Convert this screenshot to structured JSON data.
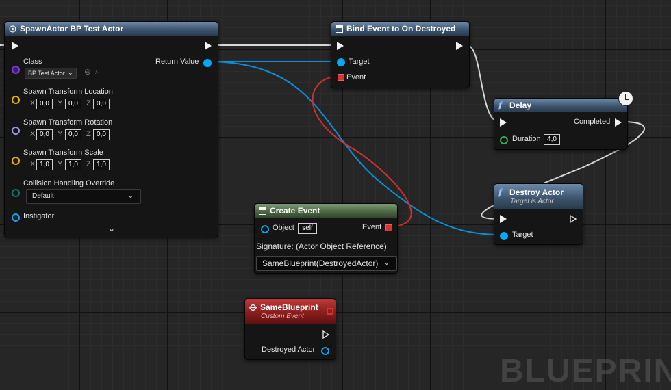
{
  "colors": {
    "exec_wire": "#d8d8d8",
    "object_wire": "#0a90d8",
    "delegate_wire": "#d23030",
    "function_header": "#3e5670",
    "create_event_header": "#4d6a45",
    "custom_event_header": "#8a1d1d"
  },
  "spawn_node": {
    "title": "SpawnActor BP Test Actor",
    "icon": "spawn-actor-icon",
    "class_label": "Class",
    "class_value": "BP Test Actor",
    "return_label": "Return Value",
    "location_label": "Spawn Transform Location",
    "location": {
      "x": "0,0",
      "y": "0,0",
      "z": "0,0"
    },
    "rotation_label": "Spawn Transform Rotation",
    "rotation": {
      "x": "0,0",
      "y": "0,0",
      "z": "0,0"
    },
    "scale_label": "Spawn Transform Scale",
    "scale": {
      "x": "1,0",
      "y": "1,0",
      "z": "1,0"
    },
    "collision_label": "Collision Handling Override",
    "collision_value": "Default",
    "instigator_label": "Instigator",
    "axis_x": "X",
    "axis_y": "Y",
    "axis_z": "Z"
  },
  "bind_node": {
    "title": "Bind Event to On Destroyed",
    "icon": "function-node-icon",
    "target_label": "Target",
    "event_label": "Event"
  },
  "delay_node": {
    "title": "Delay",
    "icon": "function-f-icon",
    "completed_label": "Completed",
    "duration_label": "Duration",
    "duration_value": "4,0"
  },
  "destroy_node": {
    "title": "Destroy Actor",
    "subtitle": "Target is Actor",
    "icon": "function-f-icon",
    "target_label": "Target"
  },
  "create_event_node": {
    "title": "Create Event",
    "object_label": "Object",
    "object_value": "self",
    "event_label": "Event",
    "signature": "Signature: (Actor Object Reference)",
    "function_value": "SameBlueprint(DestroyedActor)"
  },
  "custom_event_node": {
    "title": "SameBlueprint",
    "subtitle": "Custom Event",
    "icon": "custom-event-icon",
    "param_label": "Destroyed Actor"
  },
  "watermark": "BLUEPRINT"
}
